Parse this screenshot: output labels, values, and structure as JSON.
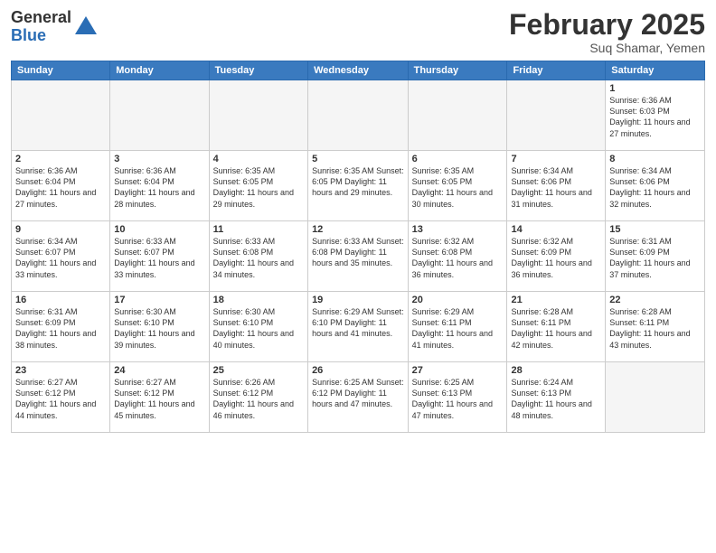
{
  "logo": {
    "general": "General",
    "blue": "Blue"
  },
  "header": {
    "month": "February 2025",
    "location": "Suq Shamar, Yemen"
  },
  "weekdays": [
    "Sunday",
    "Monday",
    "Tuesday",
    "Wednesday",
    "Thursday",
    "Friday",
    "Saturday"
  ],
  "weeks": [
    [
      {
        "day": "",
        "info": ""
      },
      {
        "day": "",
        "info": ""
      },
      {
        "day": "",
        "info": ""
      },
      {
        "day": "",
        "info": ""
      },
      {
        "day": "",
        "info": ""
      },
      {
        "day": "",
        "info": ""
      },
      {
        "day": "1",
        "info": "Sunrise: 6:36 AM\nSunset: 6:03 PM\nDaylight: 11 hours and 27 minutes."
      }
    ],
    [
      {
        "day": "2",
        "info": "Sunrise: 6:36 AM\nSunset: 6:04 PM\nDaylight: 11 hours and 27 minutes."
      },
      {
        "day": "3",
        "info": "Sunrise: 6:36 AM\nSunset: 6:04 PM\nDaylight: 11 hours and 28 minutes."
      },
      {
        "day": "4",
        "info": "Sunrise: 6:35 AM\nSunset: 6:05 PM\nDaylight: 11 hours and 29 minutes."
      },
      {
        "day": "5",
        "info": "Sunrise: 6:35 AM\nSunset: 6:05 PM\nDaylight: 11 hours and 29 minutes."
      },
      {
        "day": "6",
        "info": "Sunrise: 6:35 AM\nSunset: 6:05 PM\nDaylight: 11 hours and 30 minutes."
      },
      {
        "day": "7",
        "info": "Sunrise: 6:34 AM\nSunset: 6:06 PM\nDaylight: 11 hours and 31 minutes."
      },
      {
        "day": "8",
        "info": "Sunrise: 6:34 AM\nSunset: 6:06 PM\nDaylight: 11 hours and 32 minutes."
      }
    ],
    [
      {
        "day": "9",
        "info": "Sunrise: 6:34 AM\nSunset: 6:07 PM\nDaylight: 11 hours and 33 minutes."
      },
      {
        "day": "10",
        "info": "Sunrise: 6:33 AM\nSunset: 6:07 PM\nDaylight: 11 hours and 33 minutes."
      },
      {
        "day": "11",
        "info": "Sunrise: 6:33 AM\nSunset: 6:08 PM\nDaylight: 11 hours and 34 minutes."
      },
      {
        "day": "12",
        "info": "Sunrise: 6:33 AM\nSunset: 6:08 PM\nDaylight: 11 hours and 35 minutes."
      },
      {
        "day": "13",
        "info": "Sunrise: 6:32 AM\nSunset: 6:08 PM\nDaylight: 11 hours and 36 minutes."
      },
      {
        "day": "14",
        "info": "Sunrise: 6:32 AM\nSunset: 6:09 PM\nDaylight: 11 hours and 36 minutes."
      },
      {
        "day": "15",
        "info": "Sunrise: 6:31 AM\nSunset: 6:09 PM\nDaylight: 11 hours and 37 minutes."
      }
    ],
    [
      {
        "day": "16",
        "info": "Sunrise: 6:31 AM\nSunset: 6:09 PM\nDaylight: 11 hours and 38 minutes."
      },
      {
        "day": "17",
        "info": "Sunrise: 6:30 AM\nSunset: 6:10 PM\nDaylight: 11 hours and 39 minutes."
      },
      {
        "day": "18",
        "info": "Sunrise: 6:30 AM\nSunset: 6:10 PM\nDaylight: 11 hours and 40 minutes."
      },
      {
        "day": "19",
        "info": "Sunrise: 6:29 AM\nSunset: 6:10 PM\nDaylight: 11 hours and 41 minutes."
      },
      {
        "day": "20",
        "info": "Sunrise: 6:29 AM\nSunset: 6:11 PM\nDaylight: 11 hours and 41 minutes."
      },
      {
        "day": "21",
        "info": "Sunrise: 6:28 AM\nSunset: 6:11 PM\nDaylight: 11 hours and 42 minutes."
      },
      {
        "day": "22",
        "info": "Sunrise: 6:28 AM\nSunset: 6:11 PM\nDaylight: 11 hours and 43 minutes."
      }
    ],
    [
      {
        "day": "23",
        "info": "Sunrise: 6:27 AM\nSunset: 6:12 PM\nDaylight: 11 hours and 44 minutes."
      },
      {
        "day": "24",
        "info": "Sunrise: 6:27 AM\nSunset: 6:12 PM\nDaylight: 11 hours and 45 minutes."
      },
      {
        "day": "25",
        "info": "Sunrise: 6:26 AM\nSunset: 6:12 PM\nDaylight: 11 hours and 46 minutes."
      },
      {
        "day": "26",
        "info": "Sunrise: 6:25 AM\nSunset: 6:12 PM\nDaylight: 11 hours and 47 minutes."
      },
      {
        "day": "27",
        "info": "Sunrise: 6:25 AM\nSunset: 6:13 PM\nDaylight: 11 hours and 47 minutes."
      },
      {
        "day": "28",
        "info": "Sunrise: 6:24 AM\nSunset: 6:13 PM\nDaylight: 11 hours and 48 minutes."
      },
      {
        "day": "",
        "info": ""
      }
    ]
  ]
}
